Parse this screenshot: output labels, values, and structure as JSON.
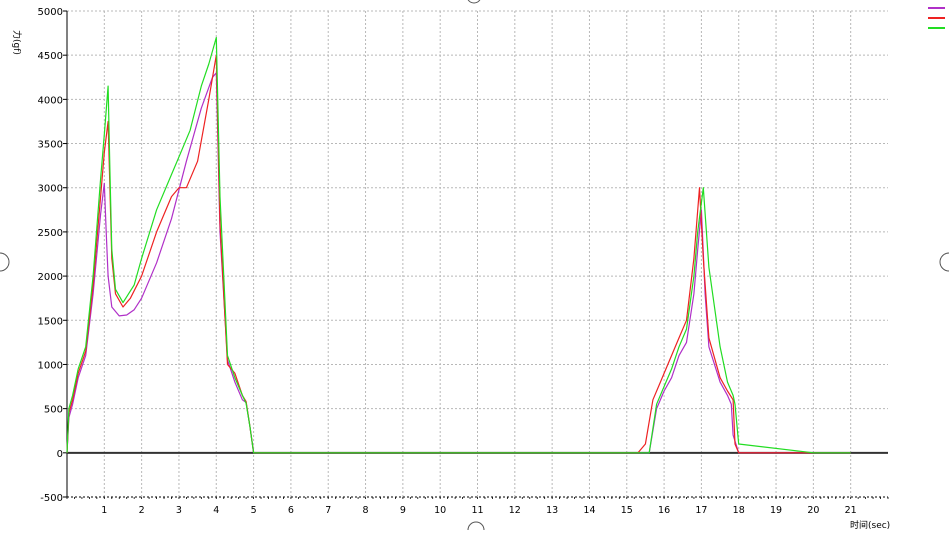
{
  "chart_data": {
    "type": "line",
    "title": "",
    "ylabel": "力(gf)",
    "xlabel": "时间(sec)",
    "xlim": [
      0,
      22
    ],
    "ylim": [
      -500,
      5000
    ],
    "y_ticks": [
      "5000",
      "4500",
      "4000",
      "3500",
      "3000",
      "2500",
      "2000",
      "1500",
      "1000",
      "500",
      "0",
      "-500"
    ],
    "x_ticks": [
      "1",
      "2",
      "3",
      "4",
      "5",
      "6",
      "7",
      "8",
      "9",
      "10",
      "11",
      "12",
      "13",
      "14",
      "15",
      "16",
      "17",
      "18",
      "19",
      "20",
      "21"
    ],
    "grid": true,
    "legend_position": "top-right",
    "series": [
      {
        "color": "#b030c8",
        "x": [
          0,
          0.05,
          0.15,
          0.3,
          0.5,
          0.7,
          0.9,
          1.0,
          1.05,
          1.1,
          1.2,
          1.4,
          1.6,
          1.8,
          2.0,
          2.4,
          2.8,
          3.2,
          3.6,
          3.9,
          4.0,
          4.1,
          4.3,
          4.5,
          4.7,
          4.8,
          4.9,
          5.0,
          5.05,
          6,
          8,
          10,
          12,
          14,
          15,
          15.4,
          15.6,
          15.8,
          16.0,
          16.2,
          16.4,
          16.6,
          16.8,
          16.9,
          17.0,
          17.1,
          17.2,
          17.5,
          17.7,
          17.8,
          17.85,
          18,
          20,
          21.0
        ],
        "y": [
          0,
          400,
          550,
          850,
          1100,
          1800,
          2700,
          3050,
          2500,
          2000,
          1650,
          1550,
          1560,
          1620,
          1750,
          2150,
          2650,
          3300,
          3900,
          4250,
          4300,
          2500,
          1050,
          800,
          600,
          570,
          300,
          0,
          0,
          0,
          0,
          0,
          0,
          0,
          0,
          0,
          0,
          500,
          700,
          850,
          1100,
          1250,
          1800,
          2300,
          2750,
          1800,
          1200,
          800,
          650,
          550,
          200,
          0,
          0,
          0
        ]
      },
      {
        "color": "#ee2222",
        "x": [
          0,
          0.05,
          0.15,
          0.3,
          0.5,
          0.7,
          0.9,
          1.0,
          1.1,
          1.15,
          1.2,
          1.3,
          1.5,
          1.7,
          2.0,
          2.4,
          2.8,
          3.0,
          3.2,
          3.5,
          3.8,
          4.0,
          4.1,
          4.3,
          4.5,
          4.7,
          4.8,
          4.9,
          5.0,
          5.05,
          6,
          8,
          10,
          12,
          14,
          15,
          15.3,
          15.5,
          15.7,
          15.9,
          16.1,
          16.4,
          16.6,
          16.8,
          16.95,
          17.05,
          17.2,
          17.5,
          17.7,
          17.85,
          17.9,
          18,
          20,
          21.0
        ],
        "y": [
          0,
          450,
          600,
          900,
          1150,
          1900,
          2900,
          3400,
          3750,
          3000,
          2200,
          1800,
          1650,
          1750,
          2000,
          2500,
          2900,
          3000,
          3000,
          3300,
          4000,
          4500,
          2600,
          1000,
          900,
          650,
          580,
          300,
          0,
          0,
          0,
          0,
          0,
          0,
          0,
          0,
          0,
          100,
          600,
          800,
          1000,
          1300,
          1500,
          2200,
          3000,
          2200,
          1300,
          850,
          700,
          600,
          100,
          0,
          0,
          0
        ]
      },
      {
        "color": "#22dd22",
        "x": [
          0,
          0.05,
          0.15,
          0.3,
          0.5,
          0.7,
          0.9,
          1.0,
          1.1,
          1.15,
          1.2,
          1.3,
          1.5,
          1.8,
          2.0,
          2.4,
          2.8,
          3.0,
          3.3,
          3.6,
          3.8,
          4.0,
          4.1,
          4.3,
          4.5,
          4.7,
          4.8,
          4.9,
          5.0,
          5.05,
          6,
          8,
          10,
          12,
          14,
          15,
          15.4,
          15.6,
          15.8,
          16.0,
          16.2,
          16.4,
          16.6,
          16.8,
          16.9,
          17.05,
          17.2,
          17.5,
          17.7,
          17.85,
          17.9,
          18,
          20,
          21.0
        ],
        "y": [
          0,
          500,
          650,
          950,
          1200,
          2000,
          3100,
          3600,
          4150,
          3200,
          2300,
          1850,
          1700,
          1900,
          2200,
          2750,
          3150,
          3350,
          3650,
          4150,
          4400,
          4700,
          2900,
          1100,
          850,
          650,
          560,
          300,
          0,
          0,
          0,
          0,
          0,
          0,
          0,
          0,
          0,
          0,
          550,
          750,
          950,
          1200,
          1400,
          2000,
          2500,
          3000,
          2100,
          1200,
          800,
          650,
          550,
          100,
          0,
          0
        ]
      }
    ]
  }
}
